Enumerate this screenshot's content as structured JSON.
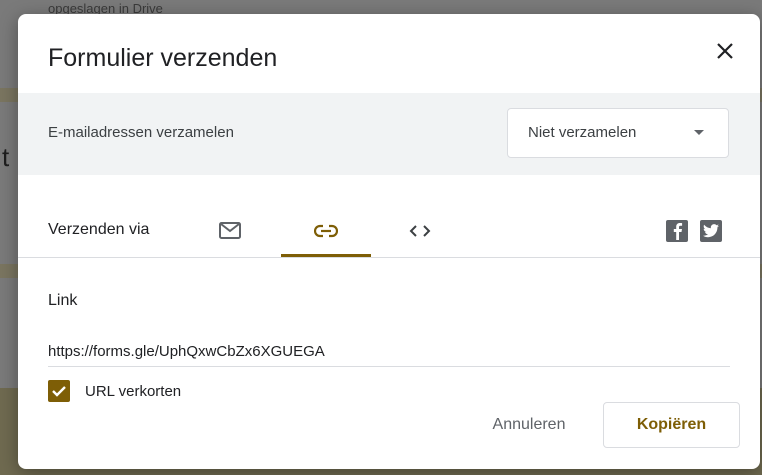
{
  "background": {
    "top_text": "opgeslagen in Drive",
    "left_letter": "t"
  },
  "dialog": {
    "title": "Formulier verzenden",
    "close_icon": "close-icon"
  },
  "collect_emails": {
    "label": "E-mailadressen verzamelen",
    "selected": "Niet verzamelen"
  },
  "send_via": {
    "label": "Verzenden via",
    "tabs": [
      {
        "icon": "email-icon",
        "active": false
      },
      {
        "icon": "link-icon",
        "active": true
      },
      {
        "icon": "embed-code-icon",
        "active": false
      }
    ],
    "social": [
      "facebook-icon",
      "twitter-icon"
    ]
  },
  "link": {
    "heading": "Link",
    "value": "https://forms.gle/UphQxwCbZx6XGUEGA",
    "shorten_label": "URL verkorten",
    "shorten_checked": true
  },
  "actions": {
    "cancel_label": "Annuleren",
    "copy_label": "Kopiëren"
  },
  "colors": {
    "accent": "#7e5e06",
    "overlay": "#7a7a7a"
  }
}
